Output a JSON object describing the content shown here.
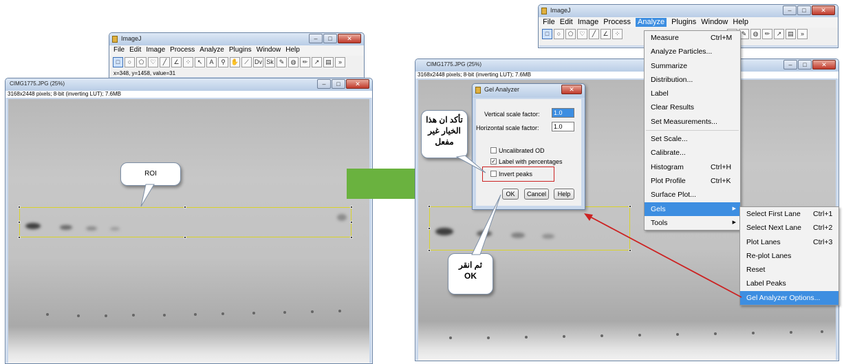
{
  "left_imagej": {
    "title": "ImageJ",
    "menus": [
      "File",
      "Edit",
      "Image",
      "Process",
      "Analyze",
      "Plugins",
      "Window",
      "Help"
    ],
    "status": "x=348, y=1458, value=31"
  },
  "left_image": {
    "title": "CIMG1775.JPG (25%)",
    "info": "3168x2448 pixels; 8-bit (inverting LUT); 7.6MB",
    "callout": "ROI"
  },
  "right_imagej": {
    "title": "ImageJ",
    "menus": [
      "File",
      "Edit",
      "Image",
      "Process",
      "Analyze",
      "Plugins",
      "Window",
      "Help"
    ]
  },
  "right_image": {
    "title": "CIMG1775.JPG (25%)",
    "info": "3168x2448 pixels; 8-bit (inverting LUT); 7.6MB"
  },
  "analyze_menu": {
    "items": [
      {
        "label": "Measure",
        "shortcut": "Ctrl+M"
      },
      {
        "label": "Analyze Particles..."
      },
      {
        "label": "Summarize"
      },
      {
        "label": "Distribution..."
      },
      {
        "label": "Label"
      },
      {
        "label": "Clear Results"
      },
      {
        "label": "Set Measurements..."
      },
      {
        "label": "Set Scale..."
      },
      {
        "label": "Calibrate..."
      },
      {
        "label": "Histogram",
        "shortcut": "Ctrl+H"
      },
      {
        "label": "Plot Profile",
        "shortcut": "Ctrl+K"
      },
      {
        "label": "Surface Plot..."
      },
      {
        "label": "Gels"
      },
      {
        "label": "Tools"
      }
    ]
  },
  "gels_submenu": {
    "items": [
      {
        "label": "Select First Lane",
        "shortcut": "Ctrl+1"
      },
      {
        "label": "Select Next Lane",
        "shortcut": "Ctrl+2"
      },
      {
        "label": "Plot Lanes",
        "shortcut": "Ctrl+3"
      },
      {
        "label": "Re-plot Lanes"
      },
      {
        "label": "Reset"
      },
      {
        "label": "Label Peaks"
      },
      {
        "label": "Gel Analyzer Options..."
      }
    ]
  },
  "gel_dialog": {
    "title": "Gel Analyzer",
    "vertical_label": "Vertical scale factor:",
    "vertical_value": "1.0",
    "horizontal_label": "Horizontal scale factor:",
    "horizontal_value": "1.0",
    "uncalibrated": "Uncalibrated OD",
    "uncalibrated_checked": false,
    "label_percentages": "Label with percentages",
    "label_percentages_checked": true,
    "invert": "Invert peaks",
    "invert_checked": false,
    "ok": "OK",
    "cancel": "Cancel",
    "help": "Help"
  },
  "callouts": {
    "check_option": "تأكد ان هذا الخيار غير مفعل",
    "then_click": "ثم انقر",
    "then_click_ok": "OK"
  },
  "colors": {
    "arrow": "#6ab23f",
    "highlight": "#3d8ee1",
    "red": "#cc2222",
    "roi": "#d9d22a"
  }
}
